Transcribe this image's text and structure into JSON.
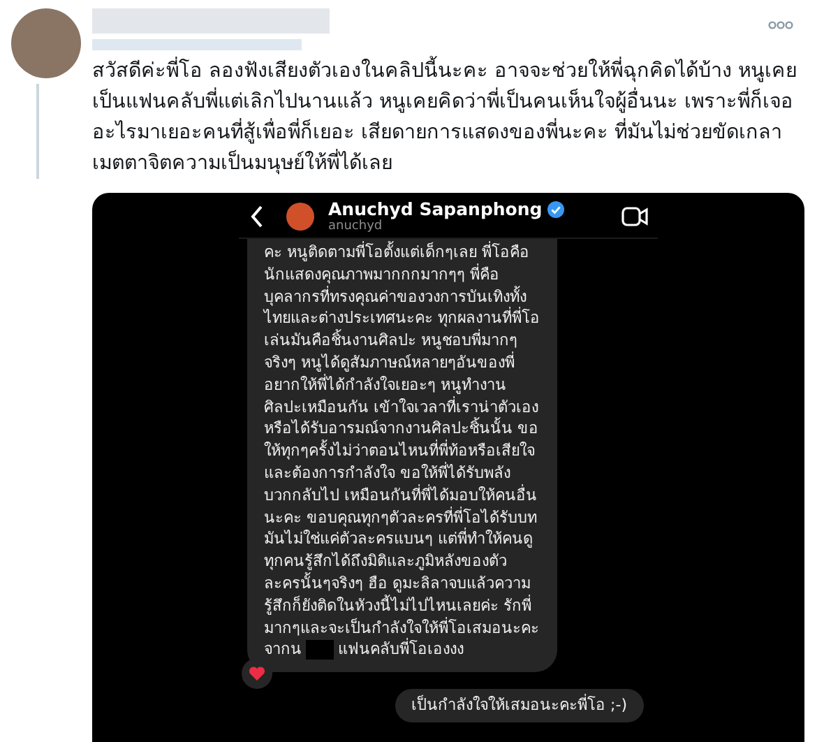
{
  "tweet": {
    "text": "สวัสดีค่ะพี่โอ ลองฟังเสียงตัวเองในคลิปนี้นะคะ อาจจะช่วยให้พี่ฉุกคิดได้บ้าง หนูเคยเป็นแฟนคลับพี่แต่เลิกไปนานแล้ว หนูเคยคิดว่าพี่เป็นคนเห็นใจผู้อื่นนะ เพราะพี่ก็เจออะไรมาเยอะคนที่สู้เพื่อพี่ก็เยอะ เสียดายการแสดงของพี่นะคะ ที่มันไม่ช่วยขัดเกลาเมตตาจิตความเป็นมนุษย์ให้พี่ได้เลย"
  },
  "chat": {
    "name": "Anuchyd Sapanphong",
    "verified": true,
    "handle": "anuchyd",
    "messages": [
      {
        "kind": "received",
        "reaction": true,
        "lines": [
          {
            "text": "คะ หนูติดตามพี่โอตั้งแต่เด็กๆเลย พี่โอคือ"
          },
          {
            "text": "นักแสดงคุณภาพมากกกมากๆๆ พี่คือ"
          },
          {
            "text": "บุคลากรที่ทรงคุณค่าของวงการบันเทิงทั้ง"
          },
          {
            "text": "ไทยและต่างประเทศนะคะ ทุกผลงานที่พี่โอ"
          },
          {
            "text": "เล่นมันคือชิ้นงานศิลปะ หนูชอบพี่มากๆ"
          },
          {
            "text": "จริงๆ หนูได้ดูสัมภาษณ์หลายๆอันของพี่"
          },
          {
            "text": "อยากให้พี่ได้กำลังใจเยอะๆ หนูทำงาน"
          },
          {
            "text": "ศิลปะเหมือนกัน เข้าใจเวลาที่เราน่าตัวเอง"
          },
          {
            "text": "หรือได้รับอารมณ์จากงานศิลปะชิ้นนั้น ขอ"
          },
          {
            "text": "ให้ทุกๆครั้งไม่ว่าตอนไหนที่พี่ท้อหรือเสียใจ"
          },
          {
            "text": "และต้องการกำลังใจ ขอให้พี่ได้รับพลัง"
          },
          {
            "text": "บวกกลับไป เหมือนกันที่พี่ได้มอบให้คนอื่น"
          },
          {
            "text": "นะคะ ขอบคุณทุกๆตัวละครที่พี่โอได้รับบท"
          },
          {
            "text": "มันไม่ใช่แค่ตัวละครแบนๆ แต่พี่ทำให้คนดู"
          },
          {
            "text": "ทุกคนรู้สึกได้ถึงมิติและภูมิหลังของตัว"
          },
          {
            "text": "ละครนั้นๆจริงๆ ฮือ ดูมะลิลาจบแล้วความ"
          },
          {
            "text": "รู้สึกก็ยังติดในหัวงนี้ไม่ไปไหนเลยค่ะ รักพี่"
          },
          {
            "text": "มากๆและจะเป็นกำลังใจให้พี่โอเสมอนะคะ"
          },
          {
            "text": "จากน",
            "redacted": true,
            "after": "แฟนคลับพี่โอเองงง"
          }
        ]
      },
      {
        "kind": "sent",
        "reaction": false,
        "lines": [
          {
            "text": "เป็นกำลังใจให้เสมอนะคะพี่โอ ;-)"
          }
        ]
      }
    ]
  }
}
